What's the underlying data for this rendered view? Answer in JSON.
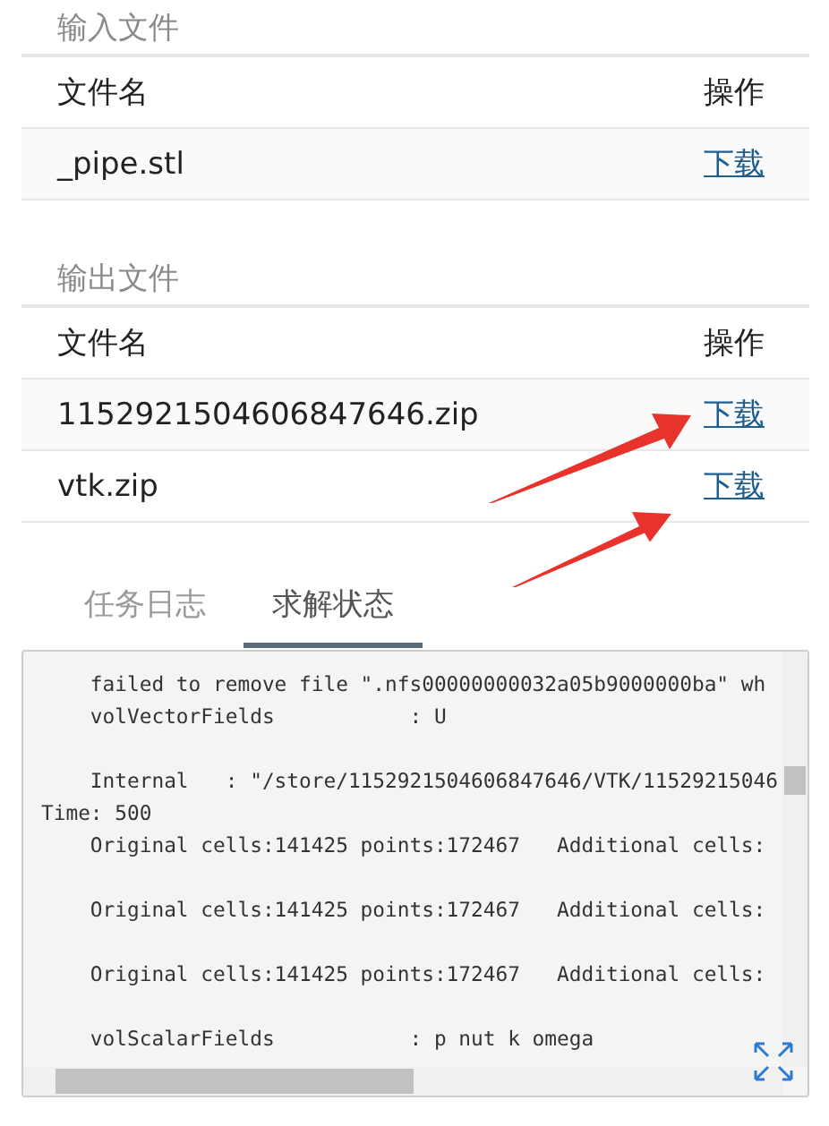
{
  "sections": [
    {
      "title": "输入文件",
      "columns": [
        "文件名",
        "操作"
      ],
      "rows": [
        {
          "name": "_pipe.stl",
          "action": "下载"
        }
      ]
    },
    {
      "title": "输出文件",
      "columns": [
        "文件名",
        "操作"
      ],
      "rows": [
        {
          "name": "1152921504606847646.zip",
          "action": "下载"
        },
        {
          "name": "vtk.zip",
          "action": "下载"
        }
      ]
    }
  ],
  "tabs": [
    {
      "label": "任务日志",
      "selected": false
    },
    {
      "label": "求解状态",
      "selected": true
    }
  ],
  "log_paragraphs": [
    [
      "    failed to remove file \".nfs00000000032a05b9000000ba\" wh",
      "    volVectorFields           : U"
    ],
    [
      "    Internal   : \"/store/1152921504606847646/VTK/11529215046",
      "Time: 500",
      "    Original cells:141425 points:172467   Additional cells:"
    ],
    [
      "    Original cells:141425 points:172467   Additional cells:"
    ],
    [
      "    Original cells:141425 points:172467   Additional cells:"
    ],
    [
      "    volScalarFields           : p nut k omega"
    ]
  ]
}
